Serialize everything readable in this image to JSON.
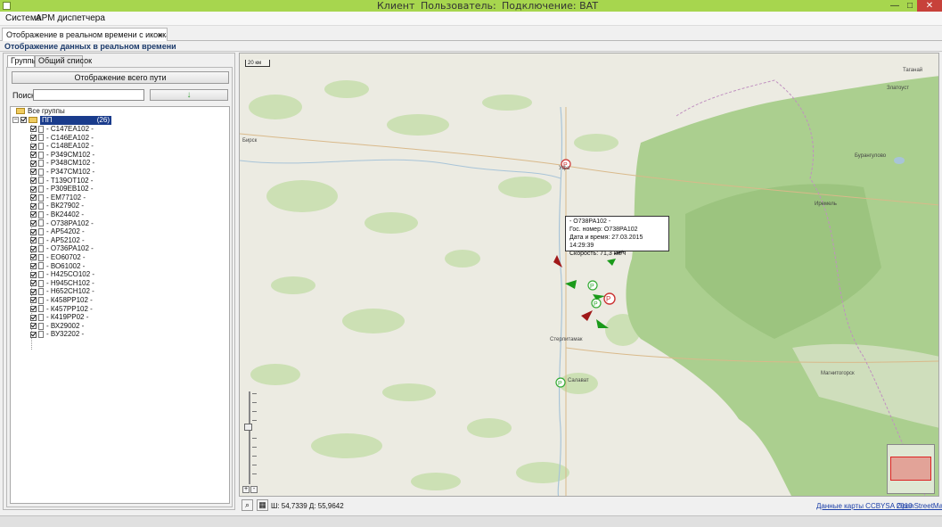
{
  "titlebar": {
    "client": "Клиент",
    "user_label": "Пользователь:",
    "connection": "Подключение: BAT",
    "minimize": "—",
    "maximize": "□",
    "close": "✕"
  },
  "menu": [
    "Система",
    "АРМ диспетчера"
  ],
  "doc_tab": {
    "label": "Отображение в реальном времени с иконками бригад",
    "close": "x"
  },
  "section_title": "Отображение данных в реальном времени",
  "left_panel": {
    "tabs": [
      "Группы",
      "Общий список"
    ],
    "show_path_button": "Отображение всего пути",
    "search_label": "Поиск",
    "search_value": "",
    "down_button": "↓",
    "tree": {
      "root": "Все группы",
      "group": {
        "name": "ПП",
        "count": "(26)"
      },
      "items": [
        "- С147ЕА102 -",
        "- С146ЕА102 -",
        "- С148ЕА102 -",
        "- Р349СМ102 -",
        "- Р348СМ102 -",
        "- Р347СМ102 -",
        "- Т139ОТ102 -",
        "- Р309ЕВ102 -",
        "- ЕМ77102 -",
        "- ВК27902 -",
        "- ВК24402 -",
        "- О738РА102 -",
        "- АР54202 -",
        "- АР52102 -",
        "- О736РА102 -",
        "- ЕО60702 -",
        "- ВО61002 -",
        "- Н425СО102 -",
        "- Н945СН102 -",
        "- Н652СН102 -",
        "- К458РР102 -",
        "- К457РР102 -",
        "- К419РР02 -",
        "- ВХ29002 -",
        "- ВУ32202 -"
      ]
    }
  },
  "map": {
    "scale_label": "20 км",
    "cities": {
      "ufa": "Уфа",
      "sterlitamak": "Стерлитамак",
      "magnitogorsk": "Магнитогорск",
      "taganay": "Таганай",
      "zlatoust": "Златоуст",
      "iremel": "Иремель",
      "burangulovo": "Бурангулово",
      "salavat": "Салават",
      "left": "Бирск"
    },
    "popup": {
      "title": "- О738РА102 -",
      "gos": "Гос. номер: О738РА102",
      "datetime": "Дата и время: 27.03.2015 14:29:39",
      "speed": "Скорость: 71,3 км/ч"
    },
    "zoom_in": "+",
    "zoom_out": "-"
  },
  "status": {
    "coords": "Ш: 54,7339  Д: 55,9642",
    "attribution": "Данные карты CCBYSA 2010",
    "osm": "OpenStreetMap"
  }
}
